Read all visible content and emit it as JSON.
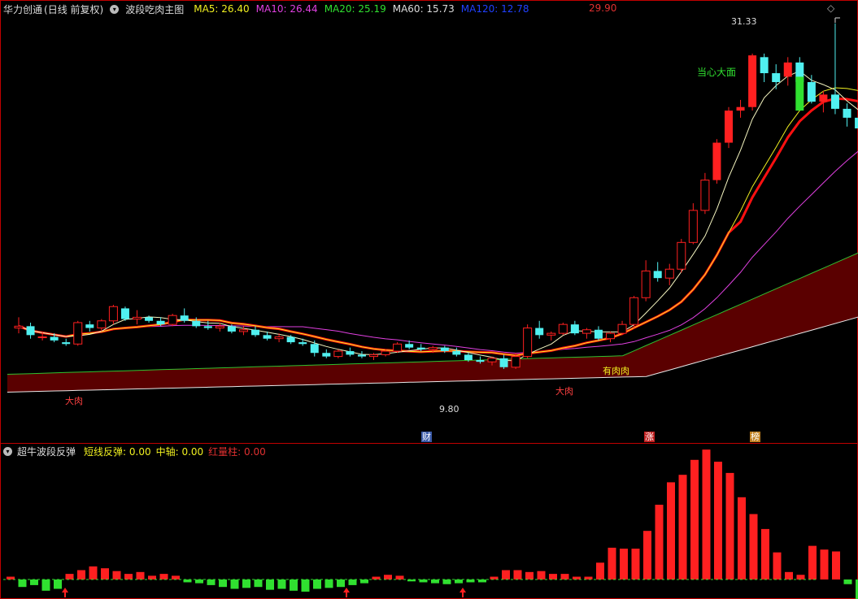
{
  "stock": {
    "name": "华力创通",
    "mode": "(日线 前复权)",
    "indicator": "波段吃肉主图",
    "price_top": "29.90"
  },
  "ma": [
    {
      "label": "MA5: 26.40",
      "color": "#f0f020"
    },
    {
      "label": "MA10: 26.44",
      "color": "#e040e0"
    },
    {
      "label": "MA20: 25.19",
      "color": "#30e030"
    },
    {
      "label": "MA60: 15.73",
      "color": "#dddddd"
    },
    {
      "label": "MA120: 12.78",
      "color": "#2040ff"
    }
  ],
  "annotations": {
    "high": "31.33",
    "low": "9.80",
    "dada": "大肉",
    "dada2": "大肉",
    "youyou": "有肉肉",
    "danger": "当心大面"
  },
  "tags": [
    {
      "text": "财",
      "color": "#3a5aa8"
    },
    {
      "text": "涨",
      "color": "#c02020"
    },
    {
      "text": "榜",
      "color": "#c08020"
    }
  ],
  "sub": {
    "title": "超牛波段反弹",
    "items": [
      {
        "label": "短线反弹: 0.00",
        "color": "#f0f020"
      },
      {
        "label": "中轴: 0.00",
        "color": "#f0f020"
      },
      {
        "label": "红量柱: 0.00",
        "color": "#e03030"
      }
    ]
  },
  "colors": {
    "up": "#ff2020",
    "down": "#50f0f0",
    "border": "#c00000",
    "green_bar": "#30e030"
  },
  "chart_data": {
    "type": "candlestick",
    "candles": [
      {
        "o": 14.2,
        "h": 14.8,
        "l": 13.9,
        "c": 14.3
      },
      {
        "o": 14.3,
        "h": 14.5,
        "l": 13.6,
        "c": 13.8
      },
      {
        "o": 13.7,
        "h": 14.0,
        "l": 13.5,
        "c": 13.7
      },
      {
        "o": 13.7,
        "h": 13.9,
        "l": 13.4,
        "c": 13.5
      },
      {
        "o": 13.4,
        "h": 13.6,
        "l": 13.2,
        "c": 13.3
      },
      {
        "o": 13.3,
        "h": 14.6,
        "l": 13.2,
        "c": 14.5
      },
      {
        "o": 14.4,
        "h": 14.6,
        "l": 14.0,
        "c": 14.2
      },
      {
        "o": 14.2,
        "h": 14.7,
        "l": 14.0,
        "c": 14.6
      },
      {
        "o": 14.6,
        "h": 15.5,
        "l": 14.4,
        "c": 15.4
      },
      {
        "o": 15.3,
        "h": 15.4,
        "l": 14.6,
        "c": 14.7
      },
      {
        "o": 14.7,
        "h": 15.2,
        "l": 14.4,
        "c": 14.8
      },
      {
        "o": 14.8,
        "h": 14.9,
        "l": 14.5,
        "c": 14.6
      },
      {
        "o": 14.6,
        "h": 14.8,
        "l": 14.3,
        "c": 14.4
      },
      {
        "o": 14.4,
        "h": 15.0,
        "l": 14.3,
        "c": 14.9
      },
      {
        "o": 14.9,
        "h": 15.3,
        "l": 14.5,
        "c": 14.6
      },
      {
        "o": 14.6,
        "h": 14.8,
        "l": 14.2,
        "c": 14.3
      },
      {
        "o": 14.3,
        "h": 14.6,
        "l": 14.1,
        "c": 14.2
      },
      {
        "o": 14.2,
        "h": 14.5,
        "l": 14.0,
        "c": 14.3
      },
      {
        "o": 14.3,
        "h": 14.4,
        "l": 13.9,
        "c": 14.0
      },
      {
        "o": 14.0,
        "h": 14.3,
        "l": 13.8,
        "c": 14.1
      },
      {
        "o": 14.1,
        "h": 14.3,
        "l": 13.7,
        "c": 13.8
      },
      {
        "o": 13.8,
        "h": 14.0,
        "l": 13.5,
        "c": 13.6
      },
      {
        "o": 13.6,
        "h": 13.9,
        "l": 13.4,
        "c": 13.7
      },
      {
        "o": 13.7,
        "h": 13.8,
        "l": 13.3,
        "c": 13.4
      },
      {
        "o": 13.4,
        "h": 13.6,
        "l": 13.2,
        "c": 13.3
      },
      {
        "o": 13.3,
        "h": 13.5,
        "l": 12.6,
        "c": 12.8
      },
      {
        "o": 12.8,
        "h": 13.0,
        "l": 12.5,
        "c": 12.6
      },
      {
        "o": 12.6,
        "h": 13.0,
        "l": 12.5,
        "c": 12.9
      },
      {
        "o": 12.9,
        "h": 13.1,
        "l": 12.6,
        "c": 12.7
      },
      {
        "o": 12.7,
        "h": 12.9,
        "l": 12.5,
        "c": 12.6
      },
      {
        "o": 12.6,
        "h": 12.8,
        "l": 12.4,
        "c": 12.7
      },
      {
        "o": 12.7,
        "h": 13.0,
        "l": 12.6,
        "c": 12.9
      },
      {
        "o": 12.9,
        "h": 13.4,
        "l": 12.8,
        "c": 13.3
      },
      {
        "o": 13.3,
        "h": 13.5,
        "l": 13.0,
        "c": 13.1
      },
      {
        "o": 13.1,
        "h": 13.3,
        "l": 12.9,
        "c": 13.0
      },
      {
        "o": 13.0,
        "h": 13.2,
        "l": 12.8,
        "c": 13.1
      },
      {
        "o": 13.1,
        "h": 13.2,
        "l": 12.8,
        "c": 12.9
      },
      {
        "o": 12.9,
        "h": 13.1,
        "l": 12.6,
        "c": 12.7
      },
      {
        "o": 12.7,
        "h": 12.8,
        "l": 12.3,
        "c": 12.4
      },
      {
        "o": 12.4,
        "h": 12.6,
        "l": 12.2,
        "c": 12.3
      },
      {
        "o": 12.3,
        "h": 12.6,
        "l": 12.1,
        "c": 12.5
      },
      {
        "o": 12.5,
        "h": 12.7,
        "l": 11.9,
        "c": 12.0
      },
      {
        "o": 12.0,
        "h": 12.8,
        "l": 11.9,
        "c": 12.6
      },
      {
        "o": 12.6,
        "h": 14.4,
        "l": 12.5,
        "c": 14.2
      },
      {
        "o": 14.2,
        "h": 14.6,
        "l": 13.6,
        "c": 13.8
      },
      {
        "o": 13.8,
        "h": 14.0,
        "l": 13.5,
        "c": 13.9
      },
      {
        "o": 13.9,
        "h": 14.5,
        "l": 13.8,
        "c": 14.4
      },
      {
        "o": 14.4,
        "h": 14.6,
        "l": 13.8,
        "c": 13.9
      },
      {
        "o": 13.9,
        "h": 14.2,
        "l": 13.6,
        "c": 14.1
      },
      {
        "o": 14.1,
        "h": 14.3,
        "l": 13.5,
        "c": 13.6
      },
      {
        "o": 13.6,
        "h": 14.0,
        "l": 13.4,
        "c": 13.9
      },
      {
        "o": 13.9,
        "h": 14.6,
        "l": 13.8,
        "c": 14.4
      },
      {
        "o": 14.4,
        "h": 16.0,
        "l": 14.2,
        "c": 15.9
      },
      {
        "o": 15.9,
        "h": 18.0,
        "l": 15.7,
        "c": 17.4
      },
      {
        "o": 17.4,
        "h": 17.9,
        "l": 16.8,
        "c": 17.0
      },
      {
        "o": 17.0,
        "h": 17.8,
        "l": 16.6,
        "c": 17.5
      },
      {
        "o": 17.5,
        "h": 19.2,
        "l": 17.3,
        "c": 19.0
      },
      {
        "o": 19.0,
        "h": 21.2,
        "l": 18.9,
        "c": 20.8
      },
      {
        "o": 20.8,
        "h": 22.9,
        "l": 20.6,
        "c": 22.5
      },
      {
        "o": 22.5,
        "h": 24.8,
        "l": 22.3,
        "c": 24.6
      },
      {
        "o": 24.6,
        "h": 26.6,
        "l": 24.3,
        "c": 26.4
      },
      {
        "o": 26.4,
        "h": 27.0,
        "l": 26.0,
        "c": 26.6
      },
      {
        "o": 26.6,
        "h": 29.6,
        "l": 26.4,
        "c": 29.5
      },
      {
        "o": 29.4,
        "h": 29.6,
        "l": 28.0,
        "c": 28.5
      },
      {
        "o": 28.5,
        "h": 29.0,
        "l": 27.6,
        "c": 28.0
      },
      {
        "o": 28.3,
        "h": 29.4,
        "l": 27.8,
        "c": 29.1
      },
      {
        "o": 29.1,
        "h": 29.4,
        "l": 27.8,
        "c": 28.0
      },
      {
        "o": 28.0,
        "h": 28.4,
        "l": 26.8,
        "c": 26.9
      },
      {
        "o": 26.9,
        "h": 27.5,
        "l": 26.3,
        "c": 27.3
      },
      {
        "o": 27.3,
        "h": 31.3,
        "l": 26.2,
        "c": 26.5
      },
      {
        "o": 26.5,
        "h": 26.8,
        "l": 25.5,
        "c": 26.0
      },
      {
        "o": 26.0,
        "h": 26.8,
        "l": 24.6,
        "c": 25.4
      },
      {
        "o": 25.4,
        "h": 25.9,
        "l": 24.9,
        "c": 25.9
      },
      {
        "o": 25.9,
        "h": 30.2,
        "l": 25.6,
        "c": 29.2
      },
      {
        "o": 29.2,
        "h": 29.6,
        "l": 27.8,
        "c": 28.1
      },
      {
        "o": 28.1,
        "h": 28.6,
        "l": 27.7,
        "c": 28.3
      },
      {
        "o": 28.3,
        "h": 28.6,
        "l": 27.4,
        "c": 27.5
      },
      {
        "o": 27.0,
        "h": 27.4,
        "l": 24.6,
        "c": 25.2
      },
      {
        "o": 25.2,
        "h": 26.4,
        "l": 24.8,
        "c": 25.1
      },
      {
        "o": 26.3,
        "h": 28.2,
        "l": 24.8,
        "c": 26.3
      }
    ],
    "volume": [
      0.3,
      -0.8,
      -0.6,
      -1.2,
      -1.0,
      0.6,
      1.0,
      1.4,
      1.2,
      0.9,
      0.6,
      0.8,
      0.4,
      0.6,
      0.4,
      -0.3,
      -0.4,
      -0.6,
      -0.8,
      -1.0,
      -0.9,
      -0.8,
      -1.1,
      -1.0,
      -1.2,
      -1.3,
      -1.0,
      -0.9,
      -0.8,
      -0.6,
      -0.4,
      0.3,
      0.5,
      0.4,
      -0.2,
      -0.3,
      -0.4,
      -0.5,
      -0.4,
      -0.3,
      -0.3,
      0.3,
      1.0,
      1.0,
      0.8,
      0.9,
      0.6,
      0.6,
      0.3,
      0.3,
      1.8,
      3.4,
      3.3,
      3.3,
      5.2,
      8.0,
      10.4,
      11.2,
      12.8,
      13.9,
      12.6,
      11.4,
      8.8,
      7.0,
      5.4,
      2.9,
      0.8,
      0.5,
      3.6,
      3.2,
      3.0,
      -0.5,
      -2.4,
      0.2
    ]
  }
}
